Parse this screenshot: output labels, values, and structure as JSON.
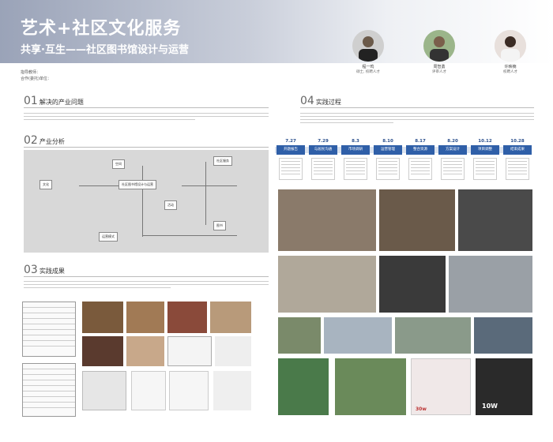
{
  "header": {
    "title": "艺术+社区文化服务",
    "subtitle": "共享·互生——社区图书馆设计与运营",
    "credits": [
      "指导教师：",
      "合作(委托)单位："
    ]
  },
  "people": [
    {
      "name": "程一鸣",
      "role": "硕士, 校聘人才"
    },
    {
      "name": "周智勇",
      "role": "评审人才"
    },
    {
      "name": "许映楠",
      "role": "校聘人才"
    }
  ],
  "sections": {
    "s1": {
      "num": "01",
      "title": "解决的产业问题"
    },
    "s2": {
      "num": "02",
      "title": "产业分析"
    },
    "s3": {
      "num": "03",
      "title": "实践成果"
    },
    "s4": {
      "num": "04",
      "title": "实践过程"
    }
  },
  "mindmap": {
    "center": "社区图书馆设计与运营",
    "nodes": [
      "空间",
      "活动",
      "运营模式",
      "社区服务",
      "图书",
      "文化"
    ]
  },
  "timeline": [
    {
      "date": "7.27",
      "step": "开题报告"
    },
    {
      "date": "7.29",
      "step": "与居民沟通"
    },
    {
      "date": "8.3",
      "step": "市场调研"
    },
    {
      "date": "8.10",
      "step": "运营管理"
    },
    {
      "date": "8.17",
      "step": "整合资源"
    },
    {
      "date": "8.20",
      "step": "方案设计"
    },
    {
      "date": "10.12",
      "step": "项目调整"
    },
    {
      "date": "10.28",
      "step": "结束成果"
    }
  ],
  "badges": {
    "v1": "30w",
    "v2": "10W"
  },
  "colors": {
    "accent": "#2f5fa8",
    "band_start": "#9aa3b8"
  }
}
